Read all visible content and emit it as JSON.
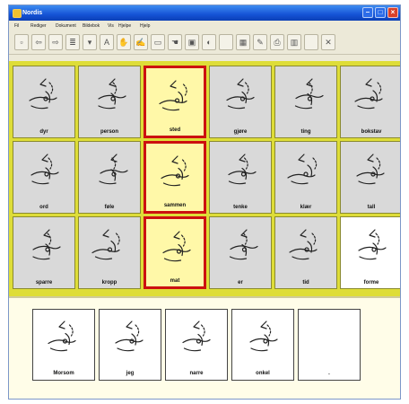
{
  "window": {
    "title": "Nordis",
    "controls": [
      "minimize-icon",
      "maximize-icon",
      "close-icon"
    ]
  },
  "menu": [
    "Fil",
    "Rediger",
    "Dokument",
    "Bildebok",
    "Vis",
    "Hjelpe",
    "Hjelp"
  ],
  "toolbar_icons": [
    "new-page-icon",
    "back-icon",
    "forward-icon",
    "list-icon",
    "filter-icon",
    "text-icon",
    "sign-icon",
    "sign-edit-icon",
    "insert-icon",
    "hand-icon",
    "picture-icon",
    "speaker-icon",
    "blank-icon",
    "grid-icon",
    "pen-icon",
    "print-icon",
    "layout-icon",
    "blank-icon",
    "close-icon"
  ],
  "grid": {
    "rows": [
      [
        {
          "label": "dyr",
          "selected": false
        },
        {
          "label": "person",
          "selected": false
        },
        {
          "label": "sted",
          "selected": true
        },
        {
          "label": "gjøre",
          "selected": false
        },
        {
          "label": "ting",
          "selected": false
        },
        {
          "label": "bokstav",
          "selected": false
        }
      ],
      [
        {
          "label": "ord",
          "selected": false
        },
        {
          "label": "føle",
          "selected": false
        },
        {
          "label": "sammen",
          "selected": true
        },
        {
          "label": "tenke",
          "selected": false
        },
        {
          "label": "klær",
          "selected": false
        },
        {
          "label": "tall",
          "selected": false
        }
      ],
      [
        {
          "label": "sparre",
          "selected": false
        },
        {
          "label": "kropp",
          "selected": false
        },
        {
          "label": "mat",
          "selected": true
        },
        {
          "label": "er",
          "selected": false
        },
        {
          "label": "tid",
          "selected": false
        },
        {
          "label": "forme",
          "selected": false,
          "white": true
        }
      ]
    ]
  },
  "sentence": {
    "cards": [
      {
        "label": "Morsom"
      },
      {
        "label": "jeg"
      },
      {
        "label": "narre"
      },
      {
        "label": "onkel"
      },
      {
        "label": "."
      }
    ]
  },
  "colors": {
    "grid_background": "#dedd38",
    "selected_border": "#cc1010",
    "selected_fill": "#fff8a8",
    "titlebar": "#1553d6"
  }
}
